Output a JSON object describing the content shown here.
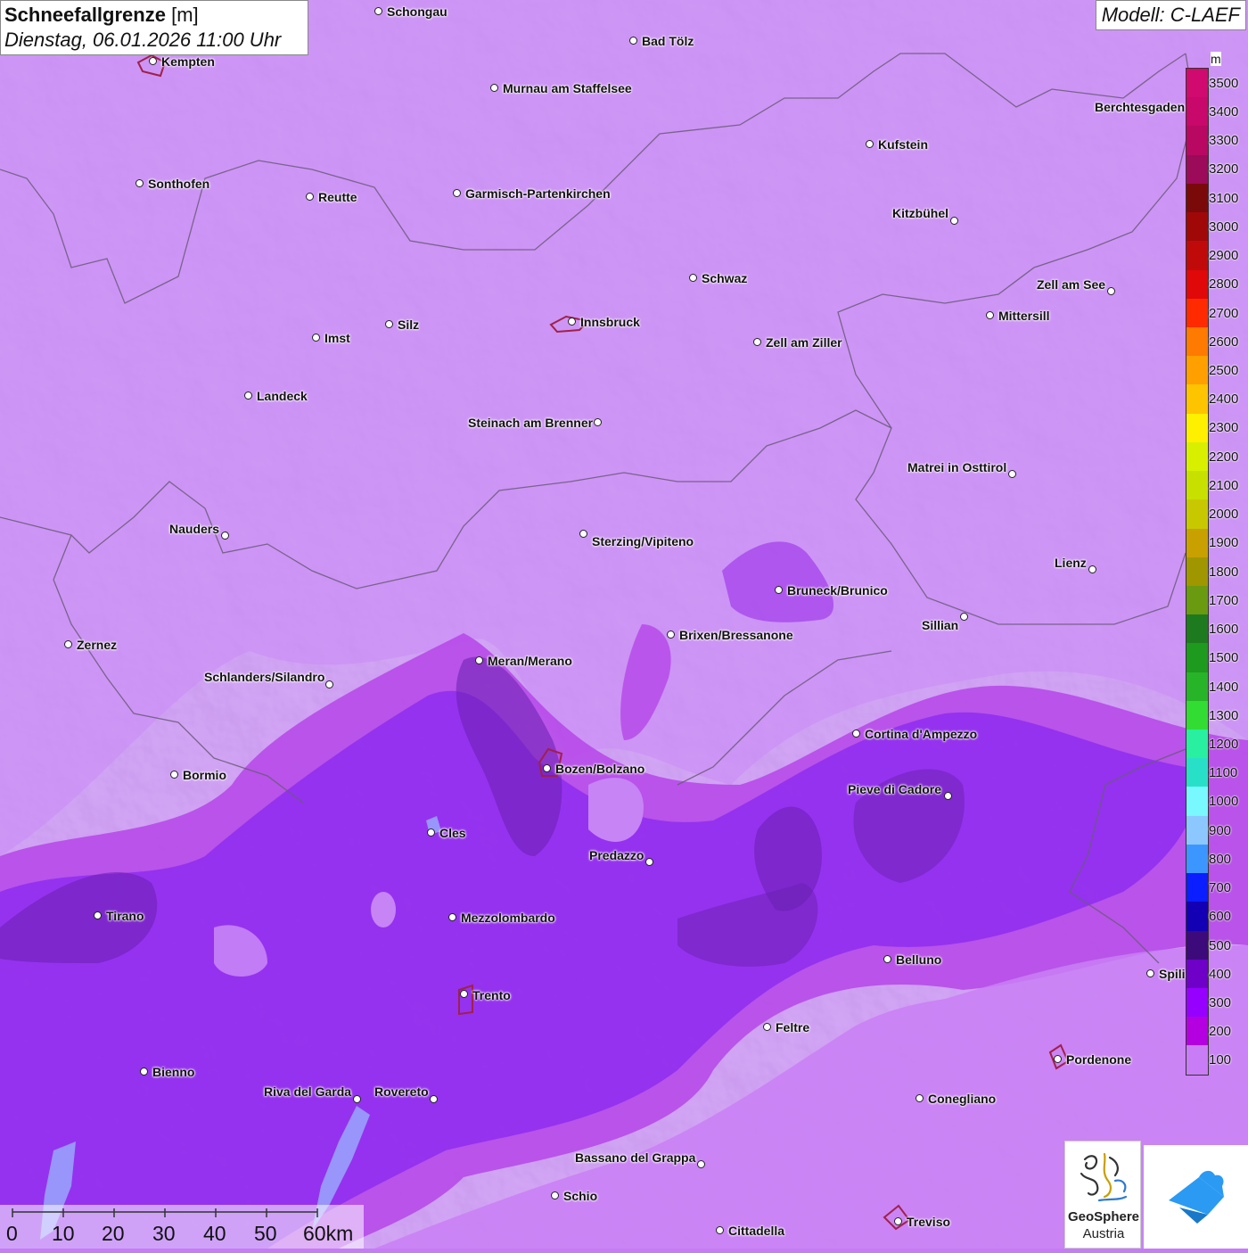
{
  "title": {
    "variable": "Schneefallgrenze",
    "unit": "[m]",
    "datetime": "Dienstag, 06.01.2026 11:00 Uhr"
  },
  "model": "Modell: C-LAEF",
  "cities": [
    "Schongau",
    "Bad Tölz",
    "Kempten",
    "Murnau am Staffelsee",
    "Berchtesgaden",
    "Kufstein",
    "Sonthofen",
    "Reutte",
    "Garmisch-Partenkirchen",
    "Kitzbühel",
    "Schwaz",
    "Zell am See",
    "Innsbruck",
    "Mittersill",
    "Imst",
    "Silz",
    "Zell am Ziller",
    "Landeck",
    "Steinach am Brenner",
    "Matrei in Osttirol",
    "Nauders",
    "Sterzing/Vipiteno",
    "Lienz",
    "Bruneck/Brunico",
    "Sillian",
    "Brixen/Bressanone",
    "Zernez",
    "Meran/Merano",
    "Schlanders/Silandro",
    "Cortina d'Ampezzo",
    "Bozen/Bolzano",
    "Bormio",
    "Pieve di Cadore",
    "Cles",
    "Predazzo",
    "Tirano",
    "Mezzolombardo",
    "Belluno",
    "Spili",
    "Trento",
    "Feltre",
    "Pordenone",
    "Bienno",
    "Riva del Garda",
    "Rovereto",
    "Conegliano",
    "Bassano del Grappa",
    "Schio",
    "Treviso",
    "Cittadella"
  ],
  "legend": {
    "unit": "m",
    "labels": [
      "3500",
      "3400",
      "3300",
      "3200",
      "3100",
      "3000",
      "2900",
      "2800",
      "2700",
      "2600",
      "2500",
      "2400",
      "2300",
      "2200",
      "2100",
      "2000",
      "1900",
      "1800",
      "1700",
      "1600",
      "1500",
      "1400",
      "1300",
      "1200",
      "1100",
      "1000",
      "900",
      "800",
      "700",
      "600",
      "500",
      "400",
      "300",
      "200",
      "100"
    ],
    "colors": [
      "#d00a6e",
      "#c8086a",
      "#b80862",
      "#9c0a5a",
      "#7a0a0a",
      "#a00808",
      "#c00a0a",
      "#e00808",
      "#ff2a00",
      "#ff7a00",
      "#ffa000",
      "#ffc400",
      "#fff000",
      "#d8f000",
      "#c8e000",
      "#c8c800",
      "#c8a000",
      "#a09600",
      "#6a9a10",
      "#1e7a1e",
      "#1e9a1e",
      "#28b428",
      "#32dc32",
      "#28f0a0",
      "#28e0c8",
      "#78f8ff",
      "#8cc8ff",
      "#3c96ff",
      "#0a1eff",
      "#1400b4",
      "#3c0a7a",
      "#6e00c8",
      "#9600ff",
      "#b400e0",
      "#c87cf5"
    ]
  },
  "scale": {
    "ticks": [
      "0",
      "10",
      "20",
      "30",
      "40",
      "50",
      "60km"
    ]
  },
  "logos": {
    "geosphere_line1": "GeoSphere",
    "geosphere_line2": "Austria"
  }
}
